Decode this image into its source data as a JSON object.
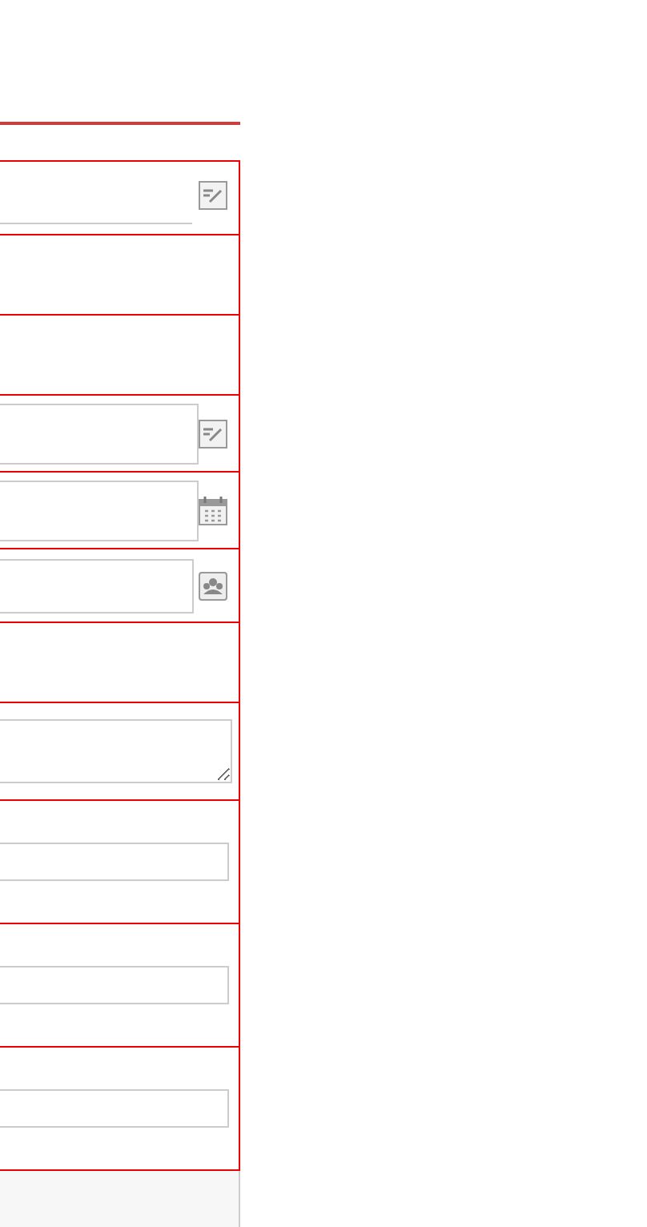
{
  "form": {
    "rows": [
      {
        "kind": "line-edit"
      },
      {
        "kind": "blank"
      },
      {
        "kind": "blank"
      },
      {
        "kind": "box-edit"
      },
      {
        "kind": "date"
      },
      {
        "kind": "lookup"
      },
      {
        "kind": "blank"
      },
      {
        "kind": "textarea"
      },
      {
        "kind": "input"
      },
      {
        "kind": "input"
      },
      {
        "kind": "input"
      }
    ]
  }
}
